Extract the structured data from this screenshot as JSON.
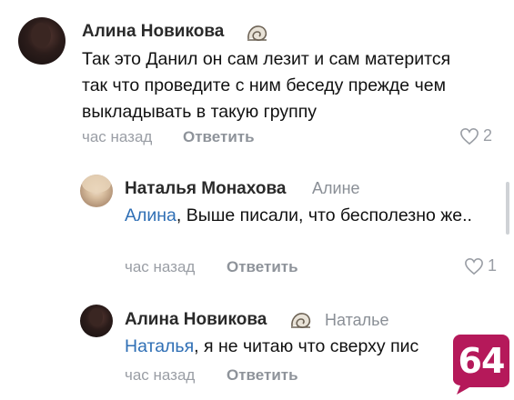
{
  "comments": [
    {
      "author": "Алина Новикова",
      "reply_to": "",
      "text": "Так это Данил он сам лезит и сам матерится так что проведите с ним беседу прежде чем выкладывать в такую группу",
      "time": "час назад",
      "reply_label": "Ответить",
      "likes": "2"
    },
    {
      "author": "Наталья Монахова",
      "reply_to": "Алине",
      "mention": "Алина",
      "text": ", Выше писали, что бесполезно же..",
      "time": "час назад",
      "reply_label": "Ответить",
      "likes": "1"
    },
    {
      "author": "Алина Новикова",
      "reply_to": "Наталье",
      "mention": "Наталья",
      "text": ", я не читаю что сверху пис",
      "time": "час назад",
      "reply_label": "Ответить",
      "likes": ""
    }
  ],
  "logo": {
    "text": "64",
    "color": "#b5195a"
  },
  "colors": {
    "mention": "#2f6fb5",
    "meta": "#9a9ea5",
    "name": "#2a2a2a"
  },
  "icons": [
    "shell-emoji-icon",
    "heart-icon"
  ]
}
